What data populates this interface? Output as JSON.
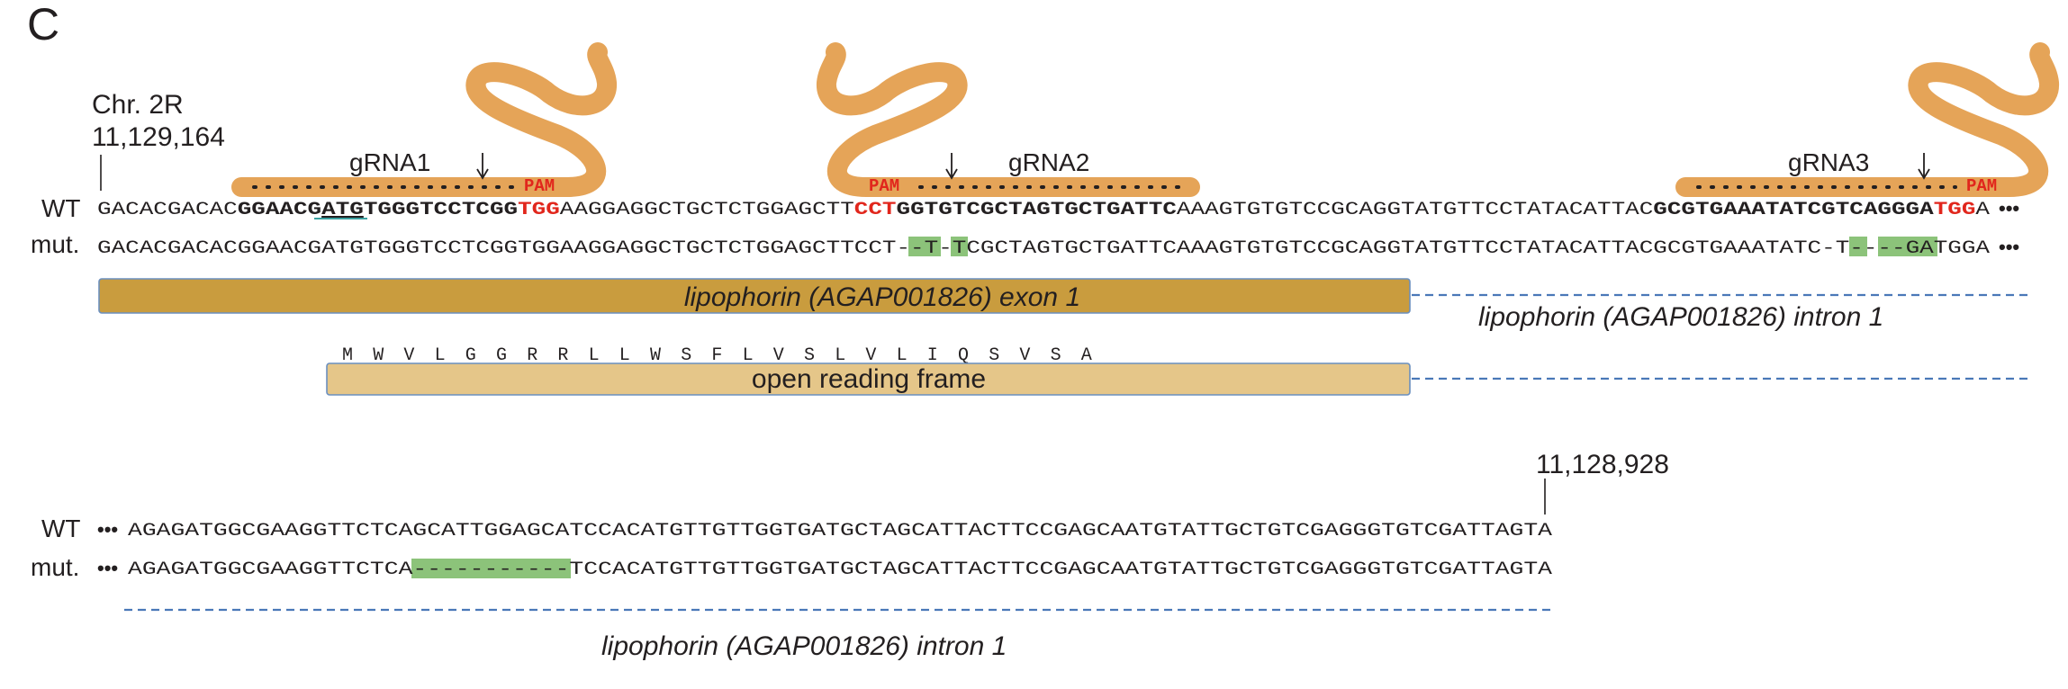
{
  "panel_label": "C",
  "coordinates": {
    "chr": "Chr. 2R",
    "start": "11,129,164",
    "end": "11,128,928"
  },
  "row_labels": {
    "wt": "WT",
    "mut": "mut."
  },
  "ellipsis": "•••",
  "grnas": [
    {
      "label": "gRNA1",
      "pam": "PAM"
    },
    {
      "label": "gRNA2",
      "pam": "PAM"
    },
    {
      "label": "gRNA3",
      "pam": "PAM"
    }
  ],
  "block1": {
    "wt": {
      "s1": "GACACGACAC",
      "s2": "GGAACG",
      "s3": "ATG",
      "s4": "TGGGTCCTCGG",
      "s5": "TGG",
      "s6": "AAGGAGGCTGCTCTGGAGCTT",
      "s7": "CCT",
      "s8": "GGTGTCGCTAGTGCTGATTC",
      "s9": "AAAGTGTGTCCGCAGGTATGTTCCTATACATTAC",
      "s10": "GCGTGAAATATCGTCAGGGA",
      "s11": "TGG",
      "s12": "A"
    },
    "mut": {
      "m1": "GACACGACACGGAACGATGTGGGTCCTCGGTGGAAGGAGGCTGCTCTGGAGCTTCCT",
      "d1": "--",
      "m2": "T",
      "d2": "-",
      "m3": "TCGCTAGTGCTGATTCAAAGTGTGTCCGCAGGTATGTTCCTATACATTACGCGTGAAATATC",
      "d3": "-",
      "m4": "T",
      "d4": "----",
      "m5": "GATGGA"
    }
  },
  "features": {
    "exon": "lipophorin (AGAP001826) exon 1",
    "intron_top": "lipophorin (AGAP001826) intron 1",
    "orf": "open reading frame",
    "intron_bottom": "lipophorin (AGAP001826) intron 1"
  },
  "amino_acids": [
    "M",
    "W",
    "V",
    "L",
    "G",
    "G",
    "R",
    "R",
    "L",
    "L",
    "W",
    "S",
    "F",
    "L",
    "V",
    "S",
    "L",
    "V",
    "L",
    "I",
    "Q",
    "S",
    "V",
    "S",
    "A"
  ],
  "block2": {
    "wt": "AGAGATGGCGAAGGTTCTCAGCATTGGAGCATCCACATGTTGTTGGTGATGCTAGCATTACTTCCGAGCAATGTATTGCTGTCGAGGGTGTCGATTAGTA",
    "mut": {
      "m1": "AGAGATGGCGAAGGTTCTCA",
      "d1": "-----------",
      "m2": "TCCACATGTTGTTGGTGATGCTAGCATTACTTCCGAGCAATGTATTGCTGTCGAGGGTGTCGATTAGTA"
    }
  },
  "colors": {
    "grna": "#e5a458",
    "exon": "#c99c3e",
    "orf": "#e5c689",
    "deletion": "#8cc37a",
    "pam": "#e1261c",
    "intron": "#4a78b8",
    "border": "#6a8fbf"
  }
}
